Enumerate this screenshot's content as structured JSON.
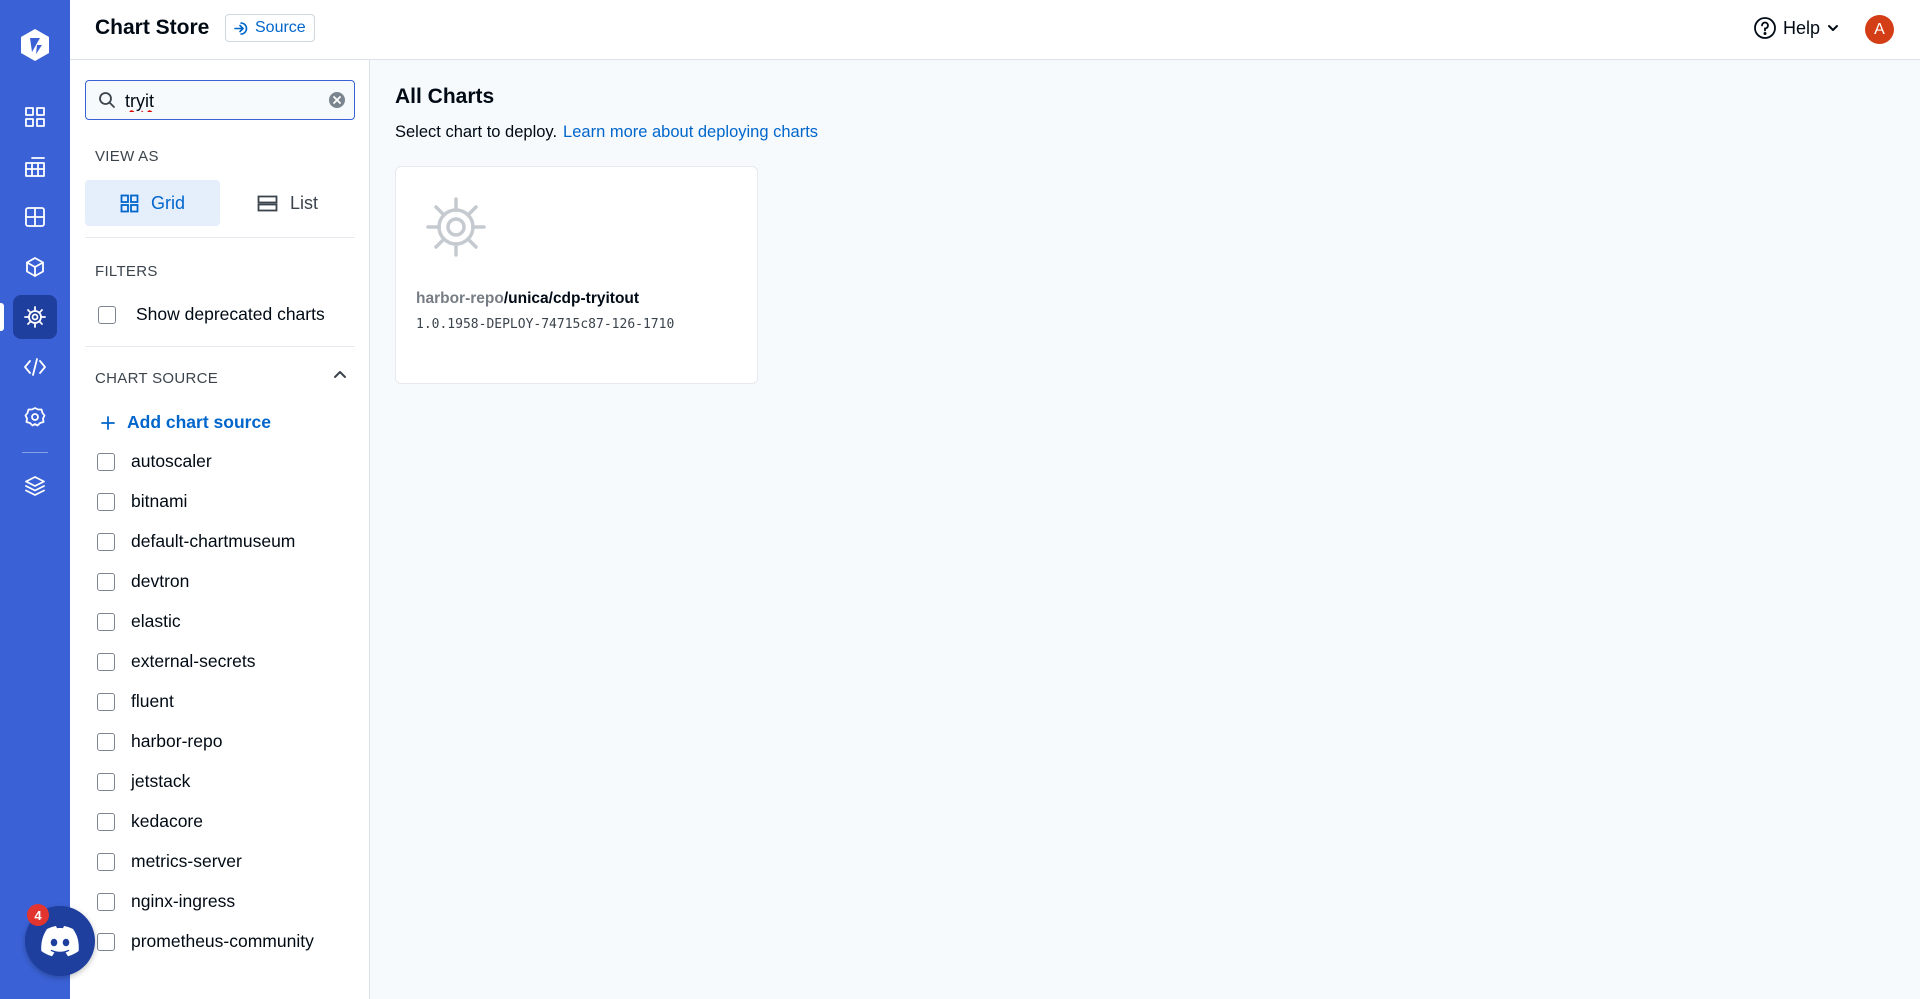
{
  "header": {
    "title": "Chart Store",
    "source_label": "Source",
    "help_label": "Help",
    "avatar_initial": "A"
  },
  "sidebar": {
    "search": {
      "value": "tryit",
      "placeholder": "Search by repository or chart"
    },
    "view_as_label": "VIEW AS",
    "view_options": [
      {
        "label": "Grid",
        "selected": true
      },
      {
        "label": "List",
        "selected": false
      }
    ],
    "filters_label": "FILTERS",
    "show_deprecated_label": "Show deprecated charts",
    "chart_source_label": "CHART SOURCE",
    "add_chart_source_label": "Add chart source",
    "sources": [
      "autoscaler",
      "bitnami",
      "default-chartmuseum",
      "devtron",
      "elastic",
      "external-secrets",
      "fluent",
      "harbor-repo",
      "jetstack",
      "kedacore",
      "metrics-server",
      "nginx-ingress",
      "prometheus-community"
    ]
  },
  "main": {
    "heading": "All Charts",
    "subtitle": "Select chart to deploy.",
    "learn_more_label": "Learn more about deploying charts",
    "charts": [
      {
        "repo": "harbor-repo",
        "name": "/unica/cdp-tryitout",
        "version": "1.0.1958-DEPLOY-74715c87-126-1710"
      }
    ]
  },
  "discord": {
    "badge_count": "4"
  },
  "colors": {
    "nav_bg": "#3a62d6",
    "nav_active": "#1f3f9f",
    "accent": "#0066cc",
    "avatar": "#d43e17",
    "badge": "#e2352f"
  }
}
